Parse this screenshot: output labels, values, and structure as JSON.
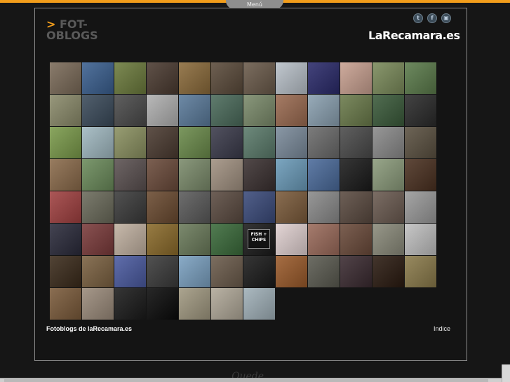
{
  "menu": {
    "label": "Menú"
  },
  "logo": {
    "prefix": ">",
    "line1": "FOT-",
    "line2": "OBLOGS"
  },
  "social": {
    "items": [
      {
        "icon": "twitter-icon",
        "glyph": "t"
      },
      {
        "icon": "facebook-icon",
        "glyph": "f"
      },
      {
        "icon": "share-icon",
        "glyph": "▣"
      }
    ]
  },
  "brand": {
    "title": "LaRecamara.es"
  },
  "footer": {
    "left": "Fotoblogs de laRecamara.es",
    "right": "Indice"
  },
  "below": {
    "text": "Quede"
  },
  "tile_label": {
    "fish": "FISH + CHIPS"
  },
  "colors": {
    "accent": "#f29d1b",
    "tiles": [
      "#7a6a58",
      "#3a5f8f",
      "#6b7a3c",
      "#4a3a30",
      "#8a6a3a",
      "#5a4a3a",
      "#6a5a4a",
      "#b8c0c8",
      "#2a2a6a",
      "#c8a090",
      "#7a8a5a",
      "#5a7a4a",
      "#8a8a6a",
      "#3a4a5a",
      "#4a4a4a",
      "#b0b0b0",
      "#5a7a9a",
      "#4a6a5a",
      "#7a8a6a",
      "#9a6a50",
      "#8aa0b0",
      "#6a7a4a",
      "#3a5a3a",
      "#2a2a2a",
      "#7a9a4a",
      "#a0b8c0",
      "#8a9060",
      "#4a3a30",
      "#6a8a4a",
      "#3a3a4a",
      "#5a7a6a",
      "#7a8a9a",
      "#6a6a6a",
      "#4a4a4a",
      "#8a8a8a",
      "#5a5040",
      "#8a6a4a",
      "#6a8a5a",
      "#5a5050",
      "#6a4a3a",
      "#7a8a6a",
      "#a09080",
      "#3a3030",
      "#6a9ab8",
      "#4a6a9a",
      "#1a1a1a",
      "#8a9a7a",
      "#4a3020",
      "#a04040",
      "#6a6a5a",
      "#3a3a3a",
      "#6a4a30",
      "#5a5a5a",
      "#5a4a40",
      "#3a4a7a",
      "#7a5a3a",
      "#8a8a8a",
      "#5a4a40",
      "#6a5a50",
      "#9a9a9a",
      "#2a2a3a",
      "#7a3a3a",
      "#c0b0a0",
      "#8a6a2a",
      "#6a7a5a",
      "#3a6a3a",
      "#1a1a1a",
      "#e0d0d0",
      "#9a6a5a",
      "#6a4a3a",
      "#8a8a7a",
      "#c0c0c0",
      "#3a2a1a",
      "#7a6040",
      "#4a5aa0",
      "#3a3a3a",
      "#7aa0c0",
      "#6a5a4a",
      "#1a1a1a",
      "#9a5a2a",
      "#5a5a50",
      "#3a2a30",
      "#2a1a10",
      "#8a7a4a",
      "#7a5a3a",
      "#9a8a7a",
      "#1a1a1a",
      "#0a0a0a",
      "#a09880",
      "#b0a898",
      "#a0b0b8"
    ]
  }
}
